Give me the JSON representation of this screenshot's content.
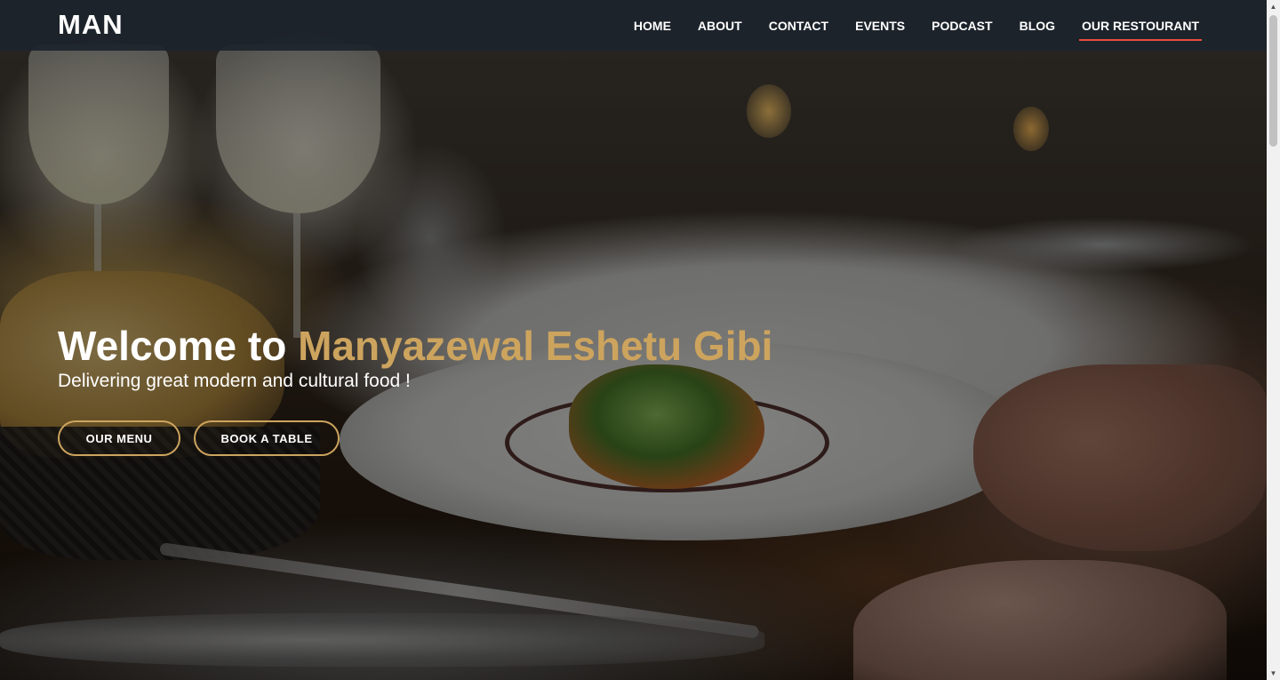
{
  "header": {
    "logo": "MAN",
    "nav": [
      {
        "label": "HOME"
      },
      {
        "label": "ABOUT"
      },
      {
        "label": "CONTACT"
      },
      {
        "label": "EVENTS"
      },
      {
        "label": "PODCAST"
      },
      {
        "label": "BLOG"
      },
      {
        "label": "OUR RESTOURANT",
        "active": true
      }
    ]
  },
  "hero": {
    "title_prefix": "Welcome to ",
    "title_accent": "Manyazewal Eshetu Gibi",
    "subtitle": "Delivering great modern and cultural food !",
    "buttons": {
      "menu": "OUR MENU",
      "book": "BOOK A TABLE"
    }
  },
  "colors": {
    "accent": "#cda45e",
    "nav_active_underline": "#e74c3c",
    "header_bg": "#1d242c"
  },
  "icons": {
    "scroll_up": "triangle-up-icon",
    "scroll_down": "triangle-down-icon"
  }
}
